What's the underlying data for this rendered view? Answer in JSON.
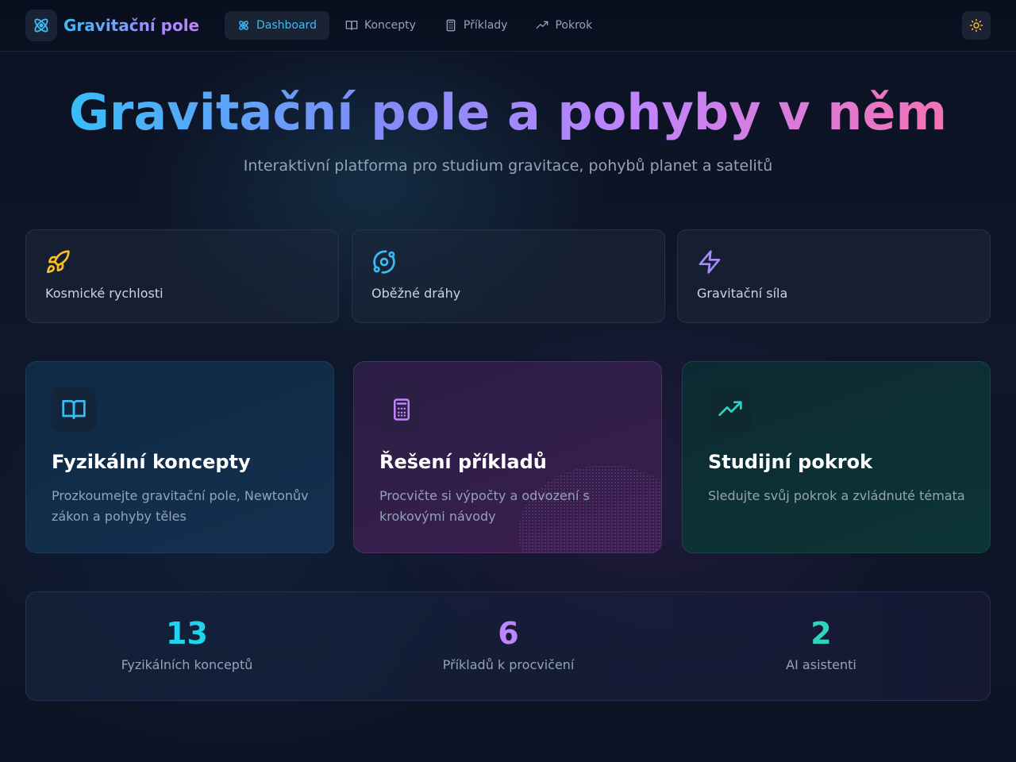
{
  "header": {
    "brand": "Gravitační pole",
    "nav": [
      {
        "label": "Dashboard",
        "icon": "atom-icon",
        "active": true
      },
      {
        "label": "Koncepty",
        "icon": "book-icon",
        "active": false
      },
      {
        "label": "Příklady",
        "icon": "calculator-icon",
        "active": false
      },
      {
        "label": "Pokrok",
        "icon": "trending-up-icon",
        "active": false
      }
    ],
    "theme_toggle_icon": "sun-icon"
  },
  "hero": {
    "title": "Gravitační pole a pohyby v něm",
    "subtitle": "Interaktivní platforma pro studium gravitace, pohybů planet a satelitů"
  },
  "topics": [
    {
      "label": "Kosmické rychlosti",
      "icon": "rocket-icon",
      "color": "#fbbf24"
    },
    {
      "label": "Oběžné dráhy",
      "icon": "orbit-icon",
      "color": "#38bdf8"
    },
    {
      "label": "Gravitační síla",
      "icon": "zap-icon",
      "color": "#a78bfa"
    }
  ],
  "cards": [
    {
      "title": "Fyzikální koncepty",
      "description": "Prozkoumejte gravitační pole, Newtonův zákon a pohyby těles",
      "icon": "book-icon",
      "color": "#38bdf8"
    },
    {
      "title": "Řešení příkladů",
      "description": "Procvičte si výpočty a odvození s krokovými návody",
      "icon": "calculator-icon",
      "color": "#c084fc"
    },
    {
      "title": "Studijní pokrok",
      "description": "Sledujte svůj pokrok a zvládnuté témata",
      "icon": "trending-up-icon",
      "color": "#2dd4bf"
    }
  ],
  "stats": [
    {
      "value": "13",
      "label": "Fyzikálních konceptů",
      "color": "#22d3ee"
    },
    {
      "value": "6",
      "label": "Příkladů k procvičení",
      "color": "#c084fc"
    },
    {
      "value": "2",
      "label": "AI asistenti",
      "color": "#2dd4bf"
    }
  ]
}
